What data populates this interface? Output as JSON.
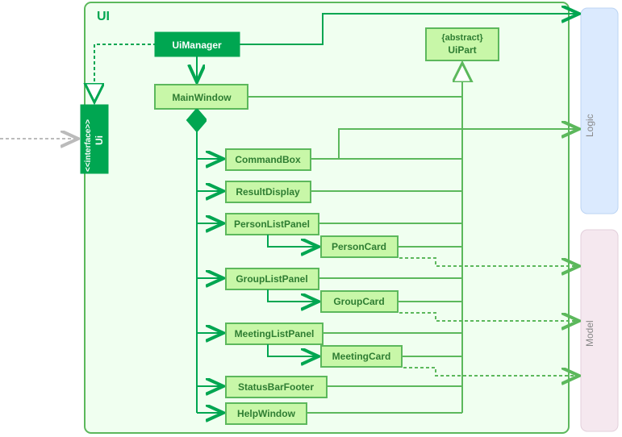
{
  "package_title": "UI",
  "interface": {
    "stereotype": "<<interface>>",
    "name": "Ui"
  },
  "ui_manager": "UiManager",
  "main_window": "MainWindow",
  "abstract": {
    "stereotype": "{abstract}",
    "name": "UiPart"
  },
  "children": {
    "command_box": "CommandBox",
    "result_display": "ResultDisplay",
    "person_list_panel": "PersonListPanel",
    "person_card": "PersonCard",
    "group_list_panel": "GroupListPanel",
    "group_card": "GroupCard",
    "meeting_list_panel": "MeetingListPanel",
    "meeting_card": "MeetingCard",
    "status_bar_footer": "StatusBarFooter",
    "help_window": "HelpWindow"
  },
  "ext": {
    "logic": "Logic",
    "model": "Model"
  }
}
